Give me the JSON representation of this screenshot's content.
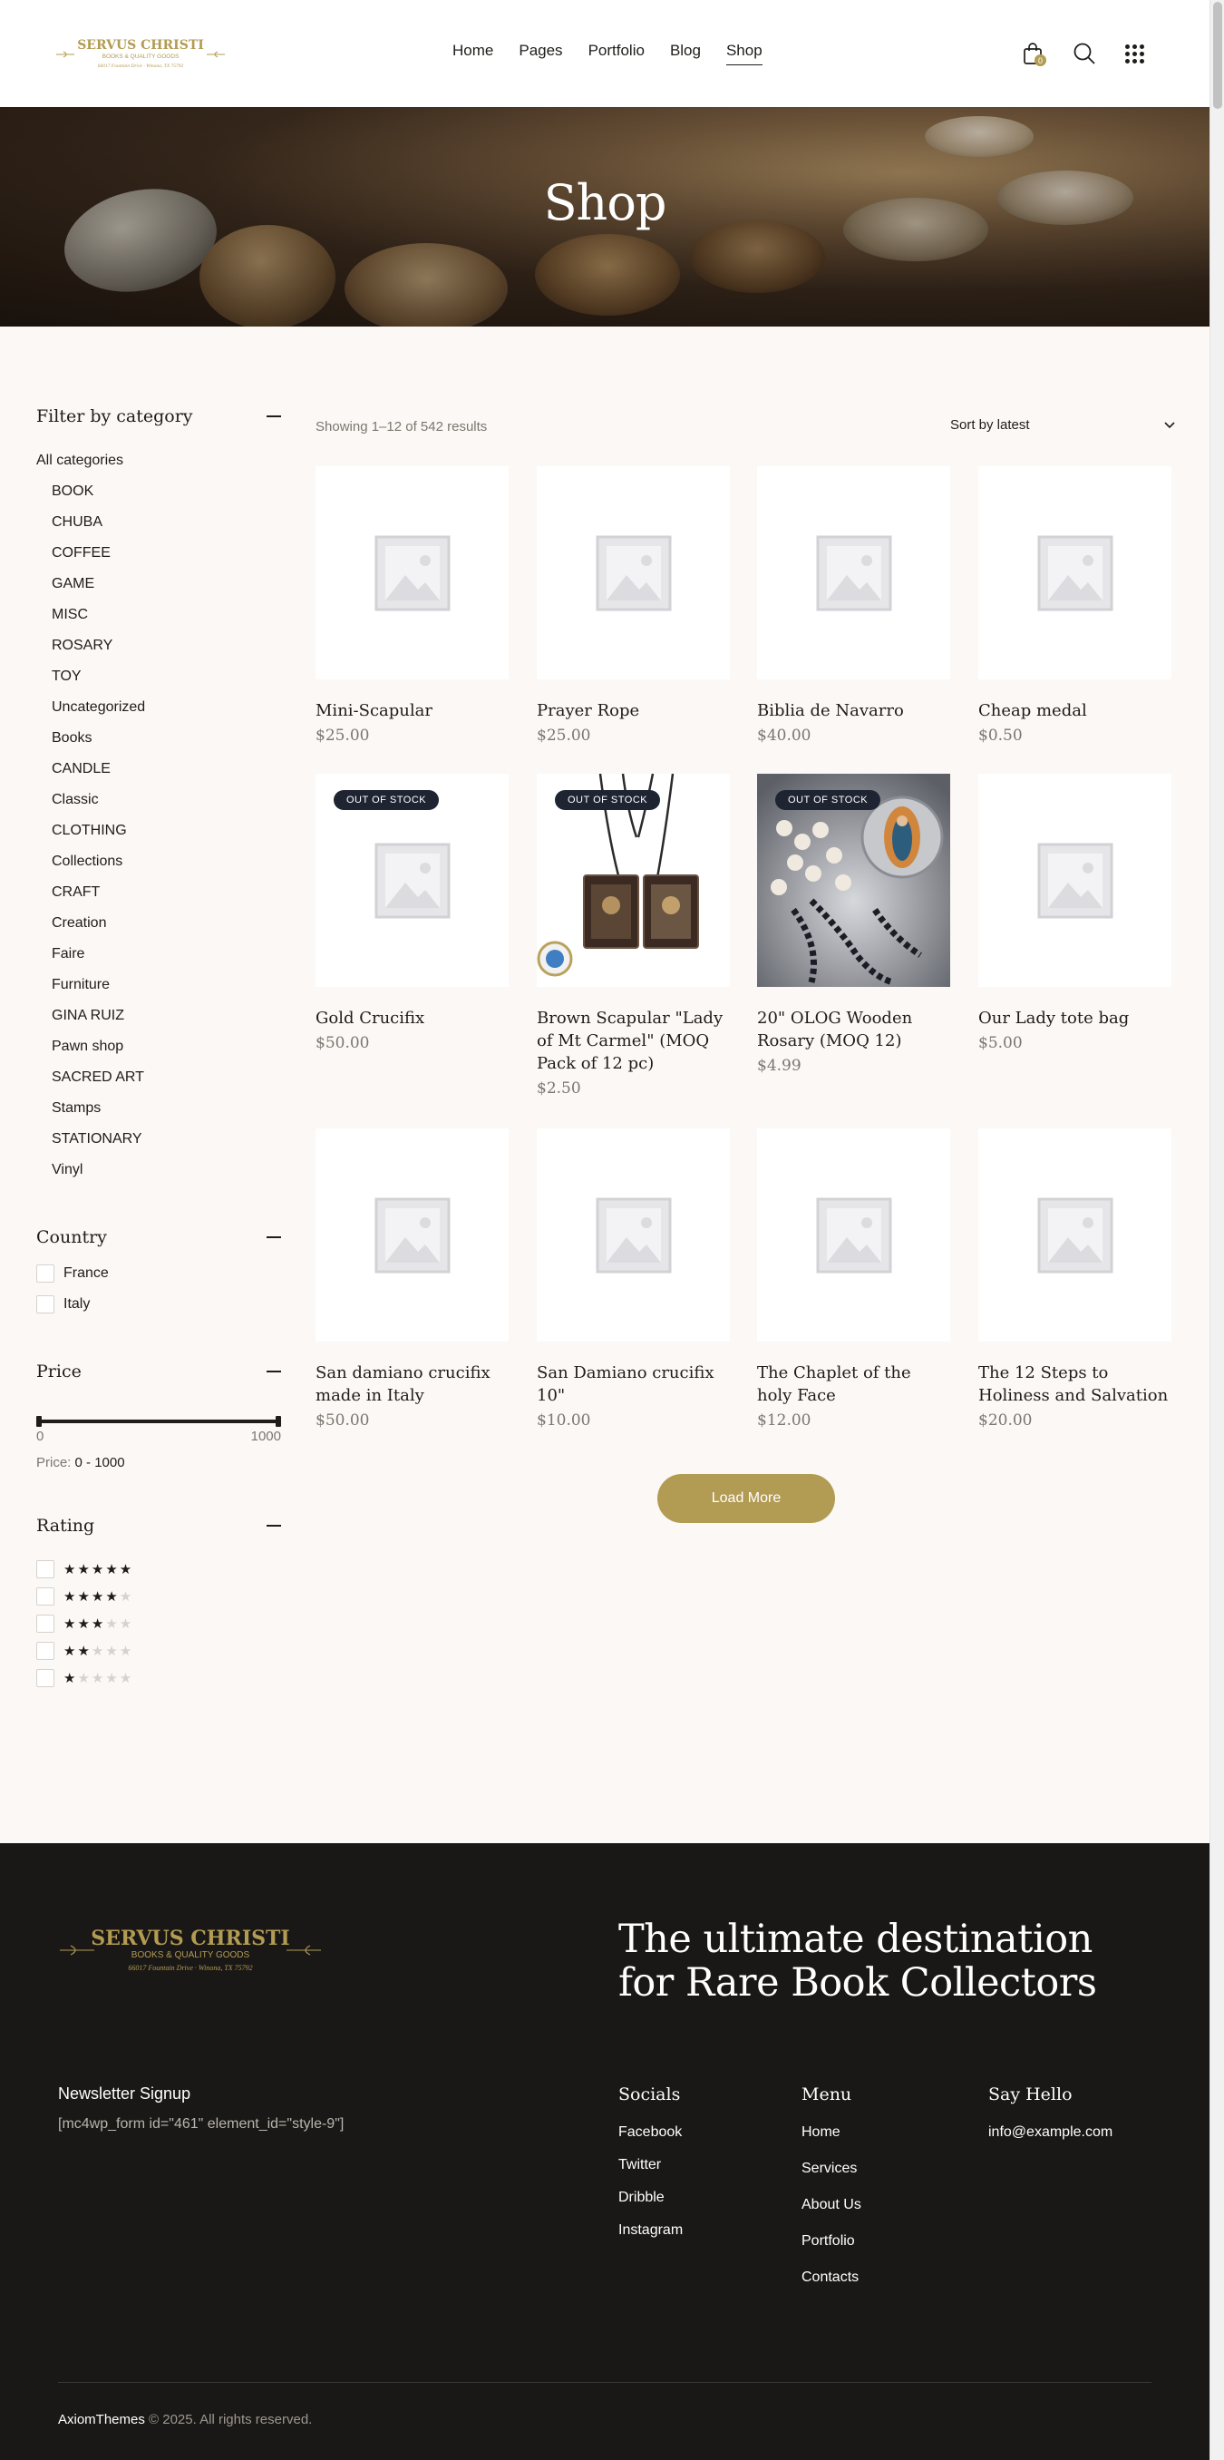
{
  "brand": {
    "name": "SERVUS CHRISTI",
    "tagline": "BOOKS & QUALITY GOODS",
    "address": "66017 Fountain Drive",
    "city": "Winona, TX 75792",
    "gold": "#b29b53"
  },
  "nav": {
    "items": [
      "Home",
      "Pages",
      "Portfolio",
      "Blog",
      "Shop"
    ],
    "active": "Shop",
    "cart_count": "0"
  },
  "hero": {
    "title": "Shop"
  },
  "sidebar": {
    "category_title": "Filter by category",
    "all_label": "All categories",
    "categories": [
      "BOOK",
      "CHUBA",
      "COFFEE",
      "GAME",
      "MISC",
      "ROSARY",
      "TOY",
      "Uncategorized",
      "Books",
      "CANDLE",
      "Classic",
      "CLOTHING",
      "Collections",
      "CRAFT",
      "Creation",
      "Faire",
      "Furniture",
      "GINA RUIZ",
      "Pawn shop",
      "SACRED ART",
      "Stamps",
      "STATIONARY",
      "Vinyl"
    ],
    "country_title": "Country",
    "countries": [
      "France",
      "Italy"
    ],
    "price_title": "Price",
    "price_min": "0",
    "price_max": "1000",
    "price_label": "Price:",
    "price_range": "0 - 1000",
    "rating_title": "Rating",
    "ratings": [
      5,
      4,
      3,
      2,
      1
    ]
  },
  "shop": {
    "result_count": "Showing 1–12 of 542 results",
    "sort_label": "Sort by latest",
    "out_of_stock_label": "OUT OF STOCK",
    "load_more_label": "Load More",
    "products": [
      {
        "title": "Mini-Scapular",
        "price": "$25.00",
        "image": "placeholder",
        "out_of_stock": false
      },
      {
        "title": "Prayer Rope",
        "price": "$25.00",
        "image": "placeholder",
        "out_of_stock": false
      },
      {
        "title": "Biblia de Navarro",
        "price": "$40.00",
        "image": "placeholder",
        "out_of_stock": false
      },
      {
        "title": "Cheap medal",
        "price": "$0.50",
        "image": "placeholder",
        "out_of_stock": false
      },
      {
        "title": "Gold Crucifix",
        "price": "$50.00",
        "image": "placeholder",
        "out_of_stock": true
      },
      {
        "title": "Brown Scapular \"Lady of Mt Carmel\" (MOQ Pack of 12 pc)",
        "price": "$2.50",
        "image": "scapular-photo",
        "out_of_stock": true
      },
      {
        "title": "20\" OLOG Wooden Rosary (MOQ 12)",
        "price": "$4.99",
        "image": "rosary-photo",
        "out_of_stock": true
      },
      {
        "title": "Our Lady tote bag",
        "price": "$5.00",
        "image": "placeholder",
        "out_of_stock": false
      },
      {
        "title": "San damiano crucifix made in Italy",
        "price": "$50.00",
        "image": "placeholder",
        "out_of_stock": false
      },
      {
        "title": "San Damiano crucifix 10\"",
        "price": "$10.00",
        "image": "placeholder",
        "out_of_stock": false
      },
      {
        "title": "The Chaplet of the holy Face",
        "price": "$12.00",
        "image": "placeholder",
        "out_of_stock": false
      },
      {
        "title": "The 12 Steps to Holiness and Salvation",
        "price": "$20.00",
        "image": "placeholder",
        "out_of_stock": false
      }
    ]
  },
  "footer": {
    "tagline_line1": "The ultimate destination",
    "tagline_line2": "for Rare Book Collectors",
    "newsletter_title": "Newsletter Signup",
    "newsletter_shortcode": "[mc4wp_form id=\"461\" element_id=\"style-9\"]",
    "socials_title": "Socials",
    "socials": [
      "Facebook",
      "Twitter",
      "Dribble",
      "Instagram"
    ],
    "menu_title": "Menu",
    "menu": [
      "Home",
      "Services",
      "About Us",
      "Portfolio",
      "Contacts"
    ],
    "hello_title": "Say Hello",
    "email": "info@example.com",
    "copyright_brand": "AxiomThemes",
    "copyright_text": "© 2025. All rights reserved."
  }
}
